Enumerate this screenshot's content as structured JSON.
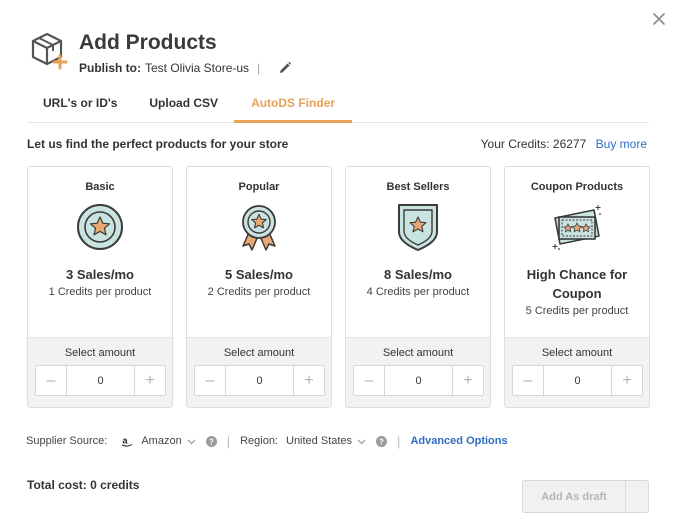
{
  "header": {
    "title": "Add Products",
    "publish_label": "Publish to:",
    "store_name": "Test Olivia Store-us",
    "separator": "|",
    "icon": "box-plus-icon"
  },
  "tabs": [
    {
      "label": "URL's or ID's",
      "active": false
    },
    {
      "label": "Upload CSV",
      "active": false
    },
    {
      "label": "AutoDS Finder",
      "active": true
    }
  ],
  "intro_text": "Let us find the perfect products for your store",
  "credits": {
    "label": "Your Credits: 26277",
    "buy_more": "Buy more"
  },
  "plans": [
    {
      "name": "Basic",
      "icon": "star-badge-icon",
      "sales": "3 Sales/mo",
      "credits": "1 Credits per product",
      "select_label": "Select amount",
      "amount": "0"
    },
    {
      "name": "Popular",
      "icon": "award-ribbon-icon",
      "sales": "5 Sales/mo",
      "credits": "2 Credits per product",
      "select_label": "Select amount",
      "amount": "0"
    },
    {
      "name": "Best Sellers",
      "icon": "shield-star-icon",
      "sales": "8 Sales/mo",
      "credits": "4 Credits per product",
      "select_label": "Select amount",
      "amount": "0"
    },
    {
      "name": "Coupon Products",
      "icon": "coupon-ticket-icon",
      "sales": "High Chance for Coupon",
      "credits": "5 Credits per product",
      "select_label": "Select amount",
      "amount": "0"
    }
  ],
  "supplier": {
    "label": "Supplier Source:",
    "value": "Amazon",
    "region_label": "Region:",
    "region_value": "United States",
    "separator": "|",
    "advanced": "Advanced Options"
  },
  "total_cost": "Total cost: 0 credits",
  "draft_button": "Add As draft",
  "colors": {
    "accent": "#e8a15a",
    "link": "#2f6ec4",
    "icon_teal": "#c9e3e0",
    "icon_star": "#e8a873"
  }
}
